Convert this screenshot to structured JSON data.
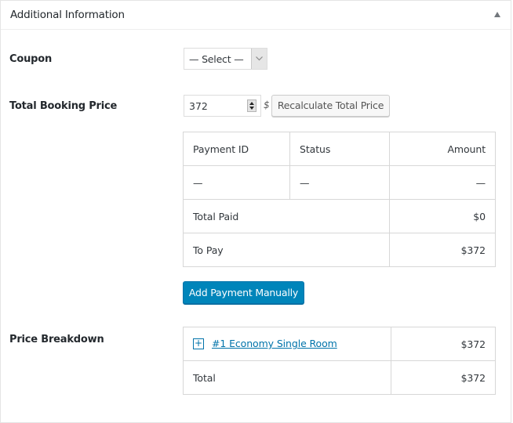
{
  "panel": {
    "title": "Additional Information",
    "toggle_icon": "triangle-up-icon"
  },
  "coupon": {
    "label": "Coupon",
    "selected": "— Select —",
    "arrow_icon": "chevron-down-icon"
  },
  "total_price": {
    "label": "Total Booking Price",
    "value": "372",
    "currency_symbol": "$",
    "recalculate_label": "Recalculate Total Price"
  },
  "payments": {
    "headers": [
      "Payment ID",
      "Status",
      "Amount"
    ],
    "rows": [
      [
        "—",
        "—",
        "—"
      ]
    ],
    "total_paid_label": "Total Paid",
    "total_paid_value": "$0",
    "to_pay_label": "To Pay",
    "to_pay_value": "$372",
    "add_button_label": "Add Payment Manually"
  },
  "breakdown": {
    "label": "Price Breakdown",
    "items": [
      {
        "expand_icon": "plus-icon",
        "name": "#1 Economy Single Room",
        "amount": "$372"
      }
    ],
    "total_label": "Total",
    "total_value": "$372"
  },
  "colors": {
    "primary": "#0085ba",
    "link": "#0073aa",
    "border": "#d7d7d7"
  }
}
